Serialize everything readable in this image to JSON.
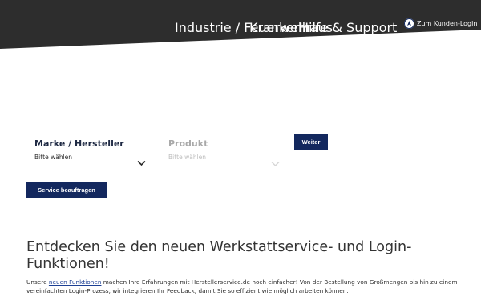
{
  "nav": {
    "industrie": "Industrie / Feuerwehr",
    "krankenhaus": "Krankenhaus",
    "hilfe": "Hilfe & Support",
    "login": "Zum Kunden-Login"
  },
  "selector": {
    "brand_label": "Marke / Hersteller",
    "brand_value": "Bitte wählen",
    "product_label": "Produkt",
    "product_value": "Bitte wählen",
    "next_button": "Weiter",
    "service_button": "Service beauftragen"
  },
  "content": {
    "headline": "Entdecken Sie den neuen Werkstattservice- und Login-Funktionen!",
    "para_pre": "Unsere ",
    "para_link": "neuen Funktionen",
    "para_post": " machen Ihre Erfahrungen mit Herstellerservice.de noch einfacher! Von der Bestellung von Großmengen bis hin zu einem vereinfachten Login-Prozess, wir integrieren Ihr Feedback, damit Sie so effizient wie möglich arbeiten können."
  },
  "colors": {
    "header_bg": "#2d2d2d",
    "accent": "#13285e",
    "link": "#1c3f94"
  },
  "icons": {
    "login": "user-circle-icon",
    "dropdown": "chevron-down-icon"
  }
}
